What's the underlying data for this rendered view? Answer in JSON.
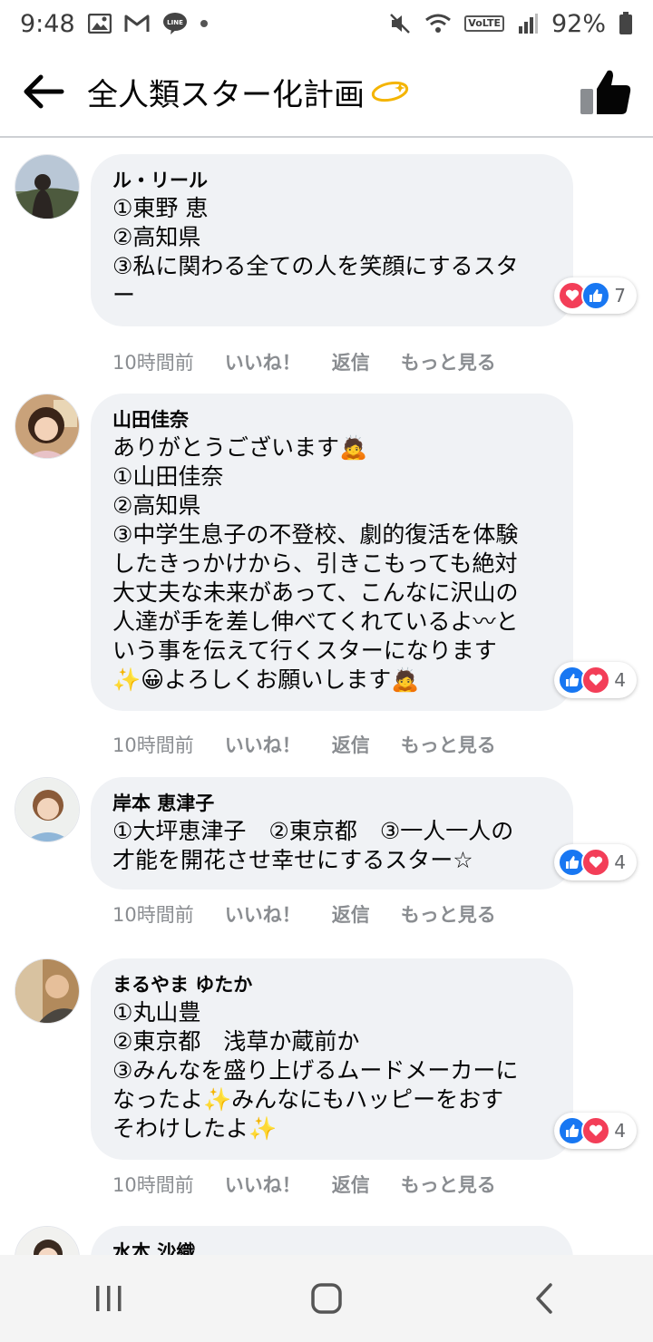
{
  "status_bar": {
    "time": "9:48",
    "battery": "92%",
    "volte": "VoLTE",
    "icons": [
      "gallery-icon",
      "gmail-icon",
      "line-icon",
      "mute-icon",
      "wifi-icon",
      "signal-icon",
      "battery-icon"
    ]
  },
  "header": {
    "title": "全人類スター化計画"
  },
  "comments": [
    {
      "author": "ル・リール",
      "lines": [
        "①東野 恵",
        "②高知県",
        "③私に関わる全ての人を笑顔にするスタ",
        "ー"
      ],
      "reaction_count": "7",
      "time": "10時間前"
    },
    {
      "author": "山田佳奈",
      "lines": [
        "ありがとうございます🙇",
        "①山田佳奈",
        "②高知県",
        "③中学生息子の不登校、劇的復活を体験",
        "したきっかけから、引きこもっても絶対",
        "大丈夫な未来があって、こんなに沢山の",
        "人達が手を差し伸べてくれているよ〰と",
        "いう事を伝えて行くスターになります",
        "✨😀よろしくお願いします🙇"
      ],
      "reaction_count": "4",
      "time": "10時間前"
    },
    {
      "author": "岸本 恵津子",
      "lines": [
        "①大坪恵津子　②東京都　③一人一人の",
        "才能を開花させ幸せにするスター☆"
      ],
      "reaction_count": "4",
      "time": "10時間前"
    },
    {
      "author": "まるやま ゆたか",
      "lines": [
        "①丸山豊",
        "②東京都　浅草か蔵前か",
        "③みんなを盛り上げるムードメーカーに",
        "なったよ✨みんなにもハッピーをおす",
        "そわけしたよ✨"
      ],
      "reaction_count": "4",
      "time": "10時間前"
    },
    {
      "author": "水本 沙織"
    }
  ],
  "actions": {
    "like": "いいね！",
    "reply": "返信",
    "more": "もっと見る"
  },
  "colors": {
    "bubble": "#f0f2f5",
    "like_blue": "#1877f2",
    "love_red": "#f33e58",
    "meta_gray": "#8a8d91"
  }
}
